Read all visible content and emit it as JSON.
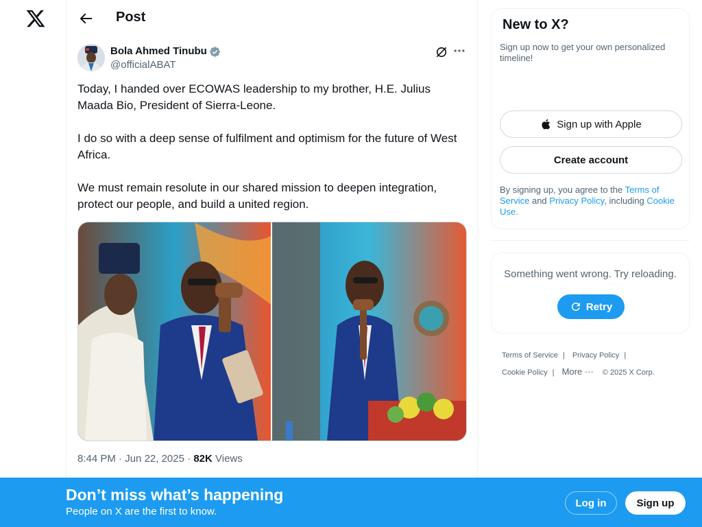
{
  "header": {
    "title": "Post"
  },
  "tweet": {
    "author_name": "Bola Ahmed Tinubu",
    "handle": "@officialABAT",
    "paragraphs": [
      "Today, I handed over ECOWAS leadership to my brother, H.E. Julius Maada Bio, President of Sierra-Leone.",
      "I do so with a deep sense of fulfilment and optimism for the future of West Africa.",
      "We must remain resolute in our shared mission to deepen integration, protect our people, and build a united region."
    ],
    "time": "8:44 PM",
    "date": "Jun 22, 2025",
    "views_count": "82K",
    "views_label": "Views",
    "separator": "·"
  },
  "sidebar": {
    "signup_title": "New to X?",
    "signup_subtitle": "Sign up now to get your own personalized timeline!",
    "apple_button": "Sign up with Apple",
    "create_button": "Create account",
    "terms": {
      "prefix": "By signing up, you agree to the ",
      "tos": "Terms of Service",
      "and": " and ",
      "privacy": "Privacy Policy",
      "including": ", including ",
      "cookie": "Cookie Use."
    },
    "error_text": "Something went wrong. Try reloading.",
    "retry_button": "Retry"
  },
  "footer": {
    "terms": "Terms of Service",
    "privacy": "Privacy Policy",
    "cookie": "Cookie Policy",
    "more": "More ···",
    "copyright": "© 2025 X Corp.",
    "divider": "|"
  },
  "bottom_bar": {
    "title": "Don’t miss what’s happening",
    "subtitle": "People on X are the first to know.",
    "login": "Log in",
    "signup": "Sign up"
  },
  "colors": {
    "accent": "#1d9bf0",
    "text": "#0f1419",
    "secondary_text": "#536471",
    "border": "#eff3f4"
  }
}
